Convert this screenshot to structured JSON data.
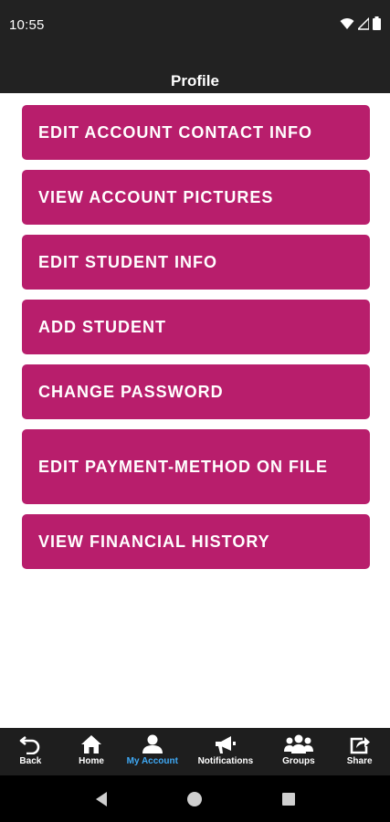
{
  "status_bar": {
    "time": "10:55"
  },
  "header": {
    "title": "Profile"
  },
  "menu": [
    {
      "label": "EDIT ACCOUNT CONTACT INFO"
    },
    {
      "label": "VIEW ACCOUNT PICTURES"
    },
    {
      "label": "EDIT STUDENT INFO"
    },
    {
      "label": "ADD STUDENT"
    },
    {
      "label": "CHANGE PASSWORD"
    },
    {
      "label": "EDIT PAYMENT-METHOD ON FILE"
    },
    {
      "label": "VIEW FINANCIAL HISTORY"
    }
  ],
  "bottom_nav": [
    {
      "label": "Back",
      "icon": "back-icon"
    },
    {
      "label": "Home",
      "icon": "home-icon"
    },
    {
      "label": "My Account",
      "icon": "person-icon",
      "active": true
    },
    {
      "label": "Notifications",
      "icon": "megaphone-icon"
    },
    {
      "label": "Groups",
      "icon": "groups-icon"
    },
    {
      "label": "Share",
      "icon": "share-icon"
    }
  ],
  "colors": {
    "button": "#b81e6c",
    "header": "#222222",
    "active_nav": "#3fa9f5"
  }
}
